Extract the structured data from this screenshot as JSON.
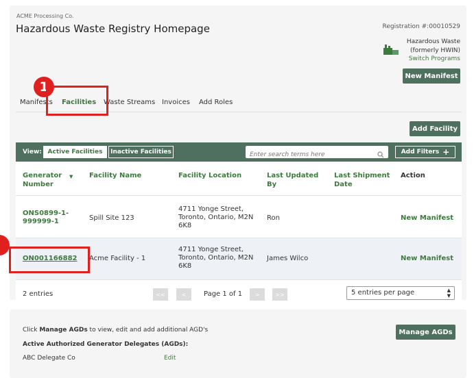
{
  "header": {
    "company": "ACME Processing Co.",
    "title": "Hazardous Waste Registry Homepage",
    "registration": "Registration #:00010529",
    "program_line1": "Hazardous Waste",
    "program_line2": "(formerly HWIN)",
    "switch_programs": "Switch Programs",
    "new_manifest_button": "New Manifest"
  },
  "tabs": [
    "Manifests",
    "Facilities",
    "Waste Streams",
    "Invoices",
    "Add Roles"
  ],
  "callouts": {
    "first": "1"
  },
  "toolbar": {
    "add_facility": "Add Facility",
    "view_label": "View:",
    "active_facilities": "Active Facilities",
    "inactive_facilities": "Inactive Facilities",
    "search_placeholder": "Enter search terms here",
    "add_filters": "Add Filters",
    "add_filters_plus": "+"
  },
  "table": {
    "columns": {
      "generator_number_l1": "Generator",
      "generator_number_l2": "Number",
      "facility_name": "Facility Name",
      "facility_location": "Facility Location",
      "last_updated_l1": "Last Updated",
      "last_updated_l2": "By",
      "last_shipment_l1": "Last Shipment",
      "last_shipment_l2": "Date",
      "action": "Action"
    },
    "rows": [
      {
        "gen_l1": "ONS0899-1-",
        "gen_l2": "999999-1",
        "name": "Spill Site 123",
        "loc_l1": "4711 Yonge Street,",
        "loc_l2": "Toronto, Ontario, M2N",
        "loc_l3": "6K8",
        "updated_by": "Ron",
        "last_shipment": "",
        "action": "New Manifest"
      },
      {
        "gen_l1": "ON001166882",
        "name": "Acme Facility - 1",
        "loc_l1": "4711 Yonge Street,",
        "loc_l2": "Toronto, Ontario, M2N",
        "loc_l3": "6K8",
        "updated_by": "James Wilco",
        "last_shipment": "",
        "action": "New Manifest"
      }
    ]
  },
  "pagination": {
    "entries": "2 entries",
    "first": "<<",
    "prev": "<",
    "page_text": "Page 1 of 1",
    "next": ">",
    "last": ">>",
    "per_page": "5 entries per page"
  },
  "agd": {
    "intro_pre": "Click ",
    "intro_bold": "Manage AGDs",
    "intro_post": " to view, edit and add additional AGD's",
    "heading": "Active Authorized Generator Delegates (AGDs):",
    "delegate_name": "ABC Delegate Co",
    "edit": "Edit",
    "manage_button": "Manage AGDs"
  },
  "colors": {
    "accent_green": "#3d7a3d",
    "dark_header": "#4f6f5f",
    "callout_red": "#e01f1f"
  }
}
